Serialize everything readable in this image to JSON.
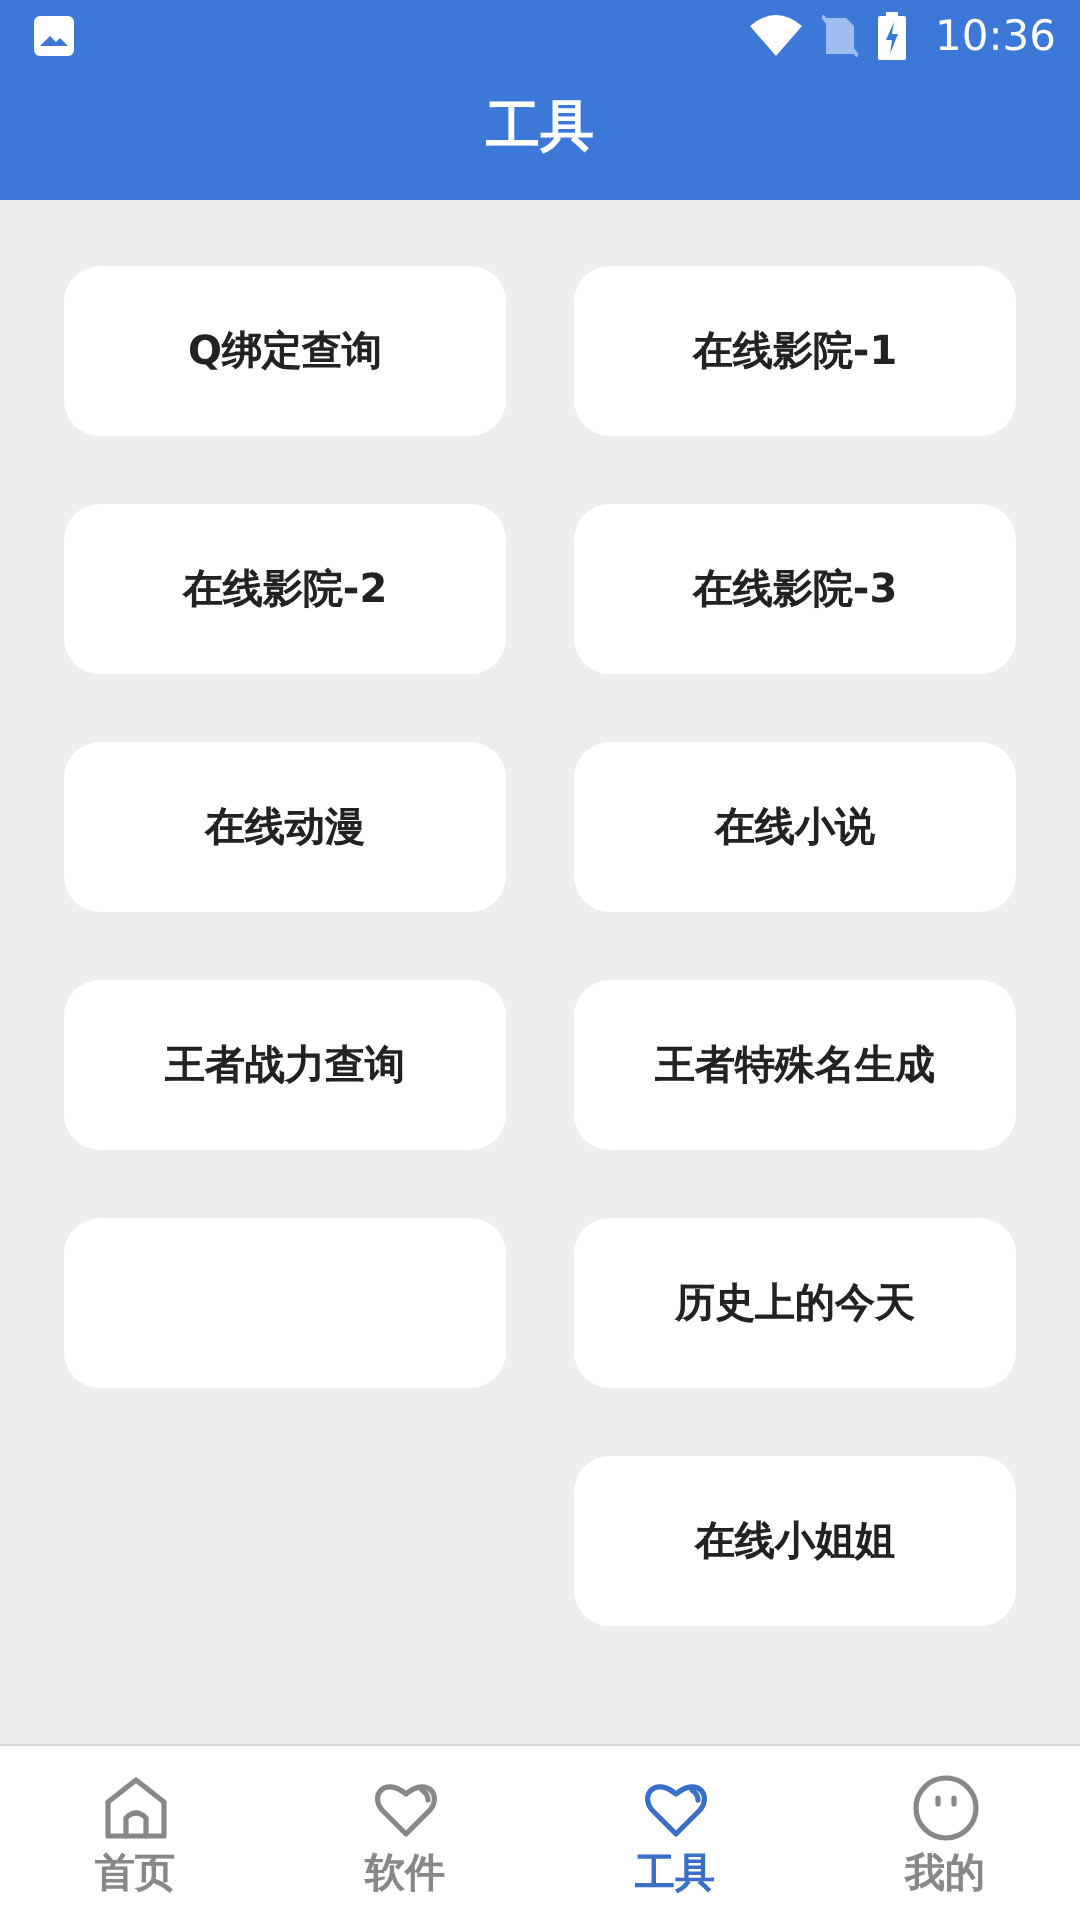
{
  "status_bar": {
    "time": "10:36"
  },
  "header": {
    "title": "工具"
  },
  "tools": [
    {
      "kind": "button",
      "label": "Q绑定查询"
    },
    {
      "kind": "button",
      "label": "在线影院-1"
    },
    {
      "kind": "button",
      "label": "在线影院-2"
    },
    {
      "kind": "button",
      "label": "在线影院-3"
    },
    {
      "kind": "button",
      "label": "在线动漫"
    },
    {
      "kind": "button",
      "label": "在线小说"
    },
    {
      "kind": "button",
      "label": "王者战力查询"
    },
    {
      "kind": "button",
      "label": "王者特殊名生成"
    },
    {
      "kind": "blank"
    },
    {
      "kind": "button",
      "label": "历史上的今天"
    },
    {
      "kind": "spacer"
    },
    {
      "kind": "button",
      "label": "在线小姐姐"
    }
  ],
  "nav": [
    {
      "label": "首页",
      "kind": "home",
      "selected": false
    },
    {
      "label": "软件",
      "kind": "heart",
      "selected": false
    },
    {
      "label": "工具",
      "kind": "heart",
      "selected": true
    },
    {
      "label": "我的",
      "kind": "face",
      "selected": false
    }
  ]
}
